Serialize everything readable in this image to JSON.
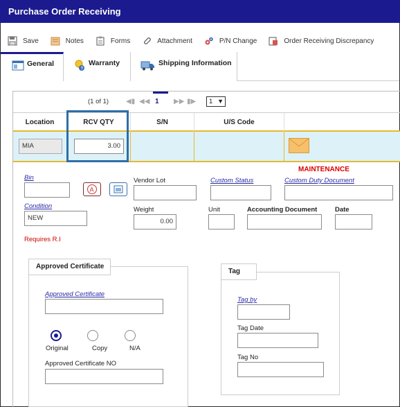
{
  "window": {
    "title": "Purchase Order Receiving"
  },
  "toolbar": {
    "save": "Save",
    "notes": "Notes",
    "forms": "Forms",
    "attachment": "Attachment",
    "pn_change": "P/N Change",
    "discrepancy": "Order Receiving Discrepancy"
  },
  "tabs": [
    {
      "label": "General",
      "active": true
    },
    {
      "label": "Warranty",
      "active": false
    },
    {
      "label": "Shipping Information",
      "active": false
    }
  ],
  "pager": {
    "summary": "(1 of 1)",
    "current": "1",
    "select_value": "1"
  },
  "grid": {
    "headers": [
      "Location",
      "RCV QTY",
      "S/N",
      "U/S Code"
    ],
    "row": {
      "location": "MIA",
      "rcv_qty": "3.00",
      "sn": "",
      "us_code": ""
    }
  },
  "form": {
    "maintenance": "MAINTENANCE",
    "bin": {
      "label": "Bin",
      "value": ""
    },
    "vendor_lot": {
      "label": "Vendor Lot",
      "value": ""
    },
    "custom_status": {
      "label": "Custom Status",
      "value": ""
    },
    "custom_duty_document": {
      "label": "Custom Duty Document",
      "value": ""
    },
    "condition": {
      "label": "Condition",
      "value": "NEW"
    },
    "weight": {
      "label": "Weight",
      "value": "0.00"
    },
    "unit": {
      "label": "Unit",
      "value": ""
    },
    "accounting_document": {
      "label": "Accounting Document",
      "value": ""
    },
    "date": {
      "label": "Date",
      "value": ""
    },
    "requires_ri": "Requires R.I"
  },
  "approved_certificate": {
    "title": "Approved Certificate",
    "field_label": "Approved Certificate",
    "field_value": "",
    "options": [
      {
        "label": "Original",
        "selected": true
      },
      {
        "label": "Copy",
        "selected": false
      },
      {
        "label": "N/A",
        "selected": false
      }
    ],
    "cert_no_label": "Approved Certificate NO",
    "cert_no_value": ""
  },
  "tag": {
    "title": "Tag",
    "tag_by_label": "Tag by",
    "tag_by_value": "",
    "tag_date_label": "Tag Date",
    "tag_date_value": "",
    "tag_no_label": "Tag No",
    "tag_no_value": ""
  },
  "colors": {
    "brand": "#1b1a8f",
    "highlight_row": "#ddf2f8",
    "row_border": "#e6b82e",
    "focus_frame": "#2e6ea6",
    "maintenance": "#d00000"
  }
}
